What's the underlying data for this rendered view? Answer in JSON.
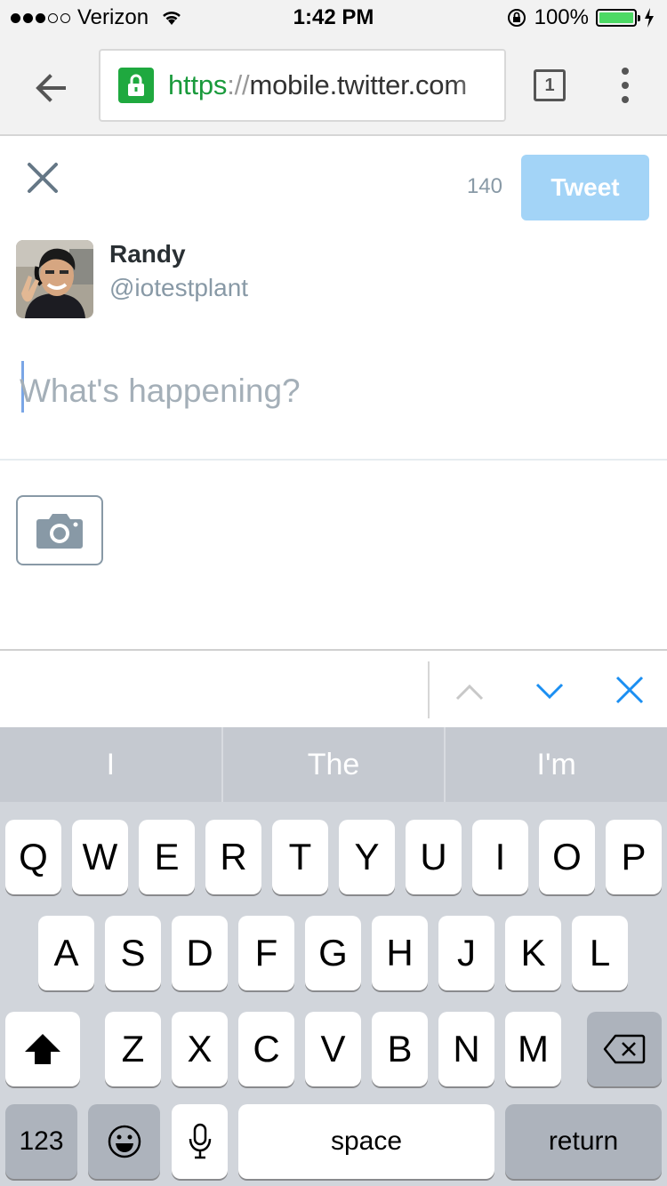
{
  "status_bar": {
    "carrier": "Verizon",
    "time": "1:42 PM",
    "battery": "100%",
    "signal_bars": 3,
    "signal_total": 5
  },
  "browser": {
    "url_scheme": "https",
    "url_separator": "://",
    "url_host": "mobile.twitter.com",
    "tab_count": "1",
    "icons": [
      "back-arrow-icon",
      "lock-icon",
      "tabs-icon",
      "menu-dots-icon"
    ],
    "secure_color": "#1fa93f"
  },
  "compose": {
    "char_count": "140",
    "tweet_label": "Tweet",
    "user_name": "Randy",
    "user_handle": "@iotestplant",
    "placeholder": "What's happening?",
    "accent_color": "#a3d4f7",
    "icons": [
      "close-icon",
      "camera-icon"
    ]
  },
  "accessory": {
    "icons": [
      "chevron-up-icon",
      "chevron-down-icon",
      "close-icon"
    ]
  },
  "keyboard": {
    "suggestions": [
      "I",
      "The",
      "I'm"
    ],
    "row1": [
      "Q",
      "W",
      "E",
      "R",
      "T",
      "Y",
      "U",
      "I",
      "O",
      "P"
    ],
    "row2": [
      "A",
      "S",
      "D",
      "F",
      "G",
      "H",
      "J",
      "K",
      "L"
    ],
    "row3": [
      "Z",
      "X",
      "C",
      "V",
      "B",
      "N",
      "M"
    ],
    "numbers_label": "123",
    "space_label": "space",
    "return_label": "return",
    "icons": [
      "shift-icon",
      "backspace-icon",
      "emoji-icon",
      "microphone-icon"
    ]
  }
}
